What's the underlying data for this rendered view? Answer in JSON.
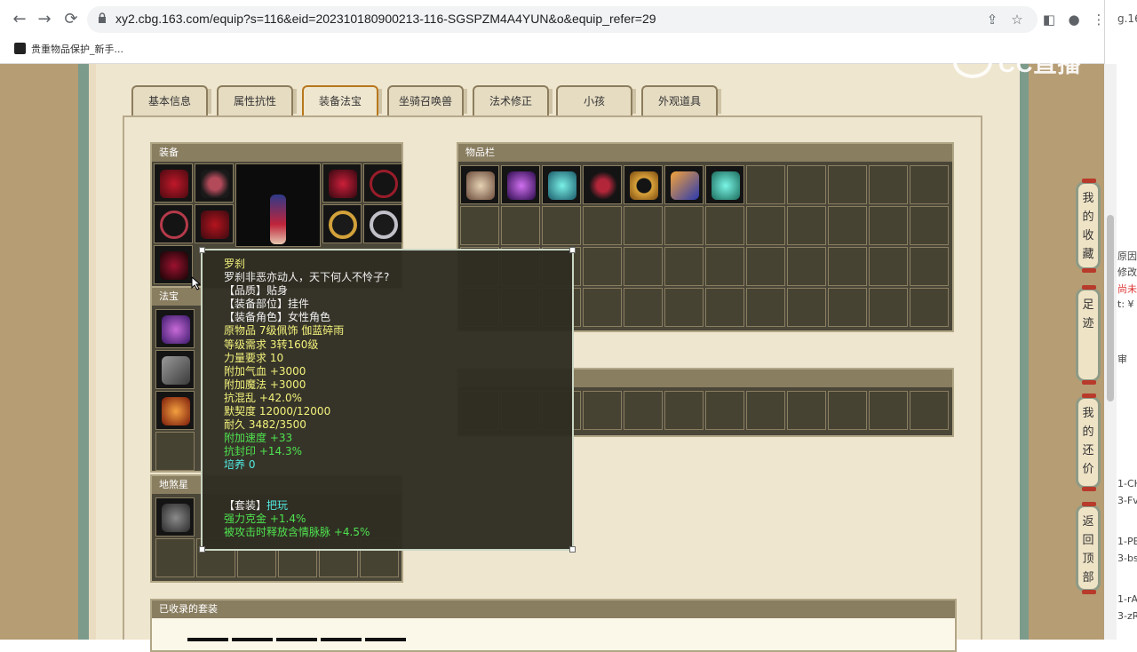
{
  "browser": {
    "url": "xy2.cbg.163.com/equip?s=116&eid=202310180900213-116-SGSPZM4A4YUN&o&equip_refer=29",
    "bookmark": "贵重物品保护_新手...",
    "side_tab": "g.16"
  },
  "watermark": "CC直播",
  "tabs": [
    "基本信息",
    "属性抗性",
    "装备法宝",
    "坐骑召唤兽",
    "法术修正",
    "小孩",
    "外观道具"
  ],
  "active_tab": "装备法宝",
  "sections": {
    "equipment": "装备",
    "fabao": "法宝",
    "disha": "地煞星",
    "inventory": "物品栏",
    "collected_sets": "已收录的套装"
  },
  "tooltip": {
    "name": "罗刹",
    "desc": "罗刹非恶亦动人，天下何人不怜子?",
    "lines": [
      {
        "text": "【品质】贴身",
        "color": "white"
      },
      {
        "text": "【装备部位】挂件",
        "color": "white"
      },
      {
        "text": "【装备角色】女性角色",
        "color": "white"
      },
      {
        "text": "原物品 7级佩饰 伽蓝碎雨",
        "color": "yellow"
      },
      {
        "text": "等级需求 3转160级",
        "color": "yellow"
      },
      {
        "text": "力量要求 10",
        "color": "yellow"
      },
      {
        "text": "附加气血 +3000",
        "color": "yellow"
      },
      {
        "text": "附加魔法 +3000",
        "color": "yellow"
      },
      {
        "text": "抗混乱 +42.0%",
        "color": "yellow"
      },
      {
        "text": "默契度 12000/12000",
        "color": "yellow"
      },
      {
        "text": "耐久 3482/3500",
        "color": "yellow"
      },
      {
        "text": "附加速度 +33",
        "color": "green"
      },
      {
        "text": "抗封印 +14.3%",
        "color": "green"
      },
      {
        "text": "培养 0",
        "color": "cyan"
      }
    ],
    "set_label": "【套装】",
    "set_name": "把玩",
    "set_lines": [
      "强力克金 +1.4%",
      "被攻击时释放含情脉脉 +4.5%"
    ]
  },
  "side_buttons": [
    "我的收藏",
    "足迹",
    "我的还价",
    "返回顶部"
  ],
  "next_window": [
    "原因",
    "修改",
    "尚未",
    "t: ¥",
    "审",
    "1-CH",
    "3-Fv",
    "1-PE",
    "3-bs",
    "1-rA",
    "3-zR"
  ]
}
